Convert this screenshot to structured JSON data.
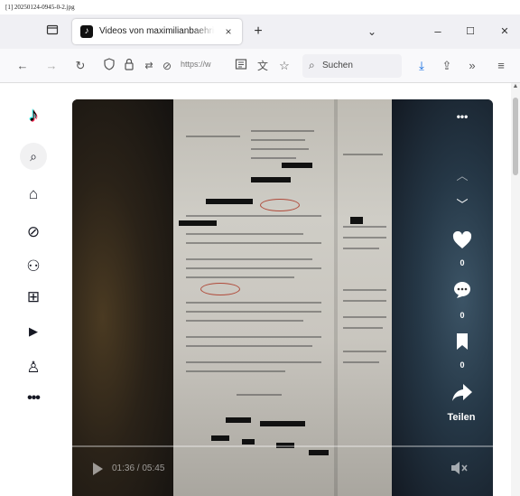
{
  "caption": "[1] 20250124-0945-0-2.jpg",
  "browser": {
    "tab": {
      "title": "Videos von maximilianbaehring",
      "close_glyph": "×"
    },
    "new_tab_glyph": "+",
    "list_tabs_glyph": "⌄",
    "window_controls": {
      "minimize": "–",
      "maximize": "☐",
      "close": "✕"
    },
    "url_text": "https://w",
    "search_placeholder": "Suchen"
  },
  "icons": {
    "tab_overview": "tab-overview-icon",
    "back": "back-arrow-icon",
    "forward": "forward-arrow-icon",
    "reload": "reload-icon",
    "shield": "tracking-shield-icon",
    "lock": "lock-icon",
    "permissions": "permissions-icon",
    "reader": "reader-view-icon",
    "translate": "translate-icon",
    "bookmark": "bookmark-star-icon",
    "download": "download-icon",
    "share": "share-icon",
    "overflow": "overflow-chevrons-icon",
    "menu": "hamburger-menu-icon"
  },
  "sidebar": {
    "items": [
      {
        "name": "tiktok-logo",
        "glyph": "♪"
      },
      {
        "name": "search",
        "glyph": "⌕"
      },
      {
        "name": "home",
        "glyph": "⌂"
      },
      {
        "name": "explore",
        "glyph": "⊘"
      },
      {
        "name": "following",
        "glyph": "⚇"
      },
      {
        "name": "upload",
        "glyph": "⊞"
      },
      {
        "name": "live",
        "glyph": "▶"
      },
      {
        "name": "profile",
        "glyph": "♙"
      },
      {
        "name": "more",
        "glyph": "•••"
      }
    ]
  },
  "video": {
    "more_glyph": "•••",
    "nav_up_glyph": "︿",
    "nav_down_glyph": "﹀",
    "like_count": "0",
    "comment_count": "0",
    "save_count": "0",
    "share_label": "Teilen",
    "time_display": "01:36 / 05:45",
    "progress": 0.28,
    "muted": true,
    "mute_glyph": "◀×"
  },
  "colors": {
    "tiktok_cyan": "#25f4ee",
    "tiktok_red": "#fe2c55",
    "download_blue": "#0060df"
  }
}
